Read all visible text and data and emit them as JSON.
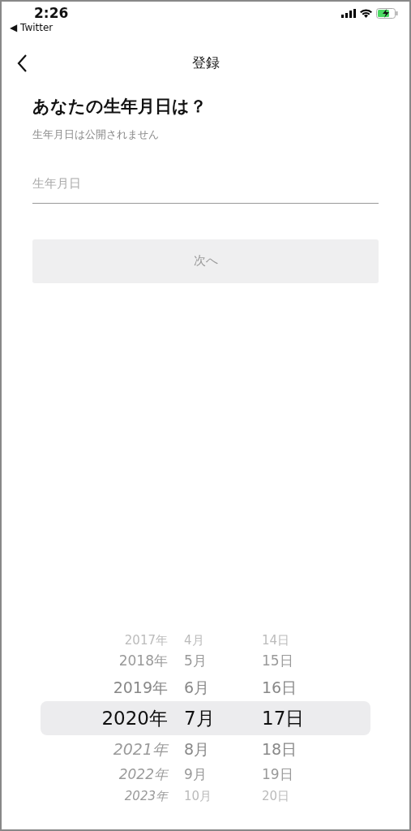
{
  "status_bar": {
    "time": "2:26",
    "back_app": "◀ Twitter"
  },
  "nav": {
    "title": "登録"
  },
  "heading": "あなたの生年月日は？",
  "subtitle": "生年月日は公開されません",
  "field": {
    "placeholder": "生年月日"
  },
  "next_button": {
    "label": "次へ",
    "disabled": true
  },
  "picker": {
    "rows": [
      {
        "year": "2017年",
        "month": "4月",
        "day": "14日",
        "selected": false,
        "year_disabled": false
      },
      {
        "year": "2018年",
        "month": "5月",
        "day": "15日",
        "selected": false,
        "year_disabled": false
      },
      {
        "year": "2019年",
        "month": "6月",
        "day": "16日",
        "selected": false,
        "year_disabled": false
      },
      {
        "year": "2020年",
        "month": "7月",
        "day": "17日",
        "selected": true,
        "year_disabled": false
      },
      {
        "year": "2021年",
        "month": "8月",
        "day": "18日",
        "selected": false,
        "year_disabled": true
      },
      {
        "year": "2022年",
        "month": "9月",
        "day": "19日",
        "selected": false,
        "year_disabled": true
      },
      {
        "year": "2023年",
        "month": "10月",
        "day": "20日",
        "selected": false,
        "year_disabled": true
      }
    ]
  }
}
